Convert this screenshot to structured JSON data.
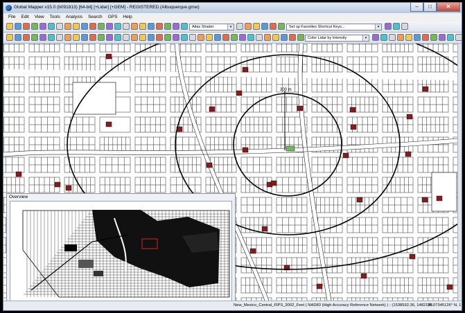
{
  "window": {
    "title": "Global Mapper v15.0 (b091813) [64-bit] [+Lidar] [+GEM] - REGISTERED (Albuquerque.gmw)",
    "minimize": "–",
    "maximize": "□",
    "close": "✕"
  },
  "menu": [
    "File",
    "Edit",
    "View",
    "Tools",
    "Analysis",
    "Search",
    "GPS",
    "Help"
  ],
  "toolbar1": {
    "shader": "Atlas Shader",
    "shortcuts": "Set up Favorites Shortcut Keys..."
  },
  "toolbar2": {
    "lidar": "Color Lidar by Intensity"
  },
  "map": {
    "range_label": "300 m"
  },
  "overview": {
    "title": "Overview"
  },
  "status": {
    "projection": "New_Mexico_Central_FIPS_3002_Feet ( NAD83 (High Accuracy Reference Network) ) - (1538592.36, 1482198.",
    "coords": "35.07345126° N, 1"
  },
  "colors": {
    "parcel_fill": "#8b1a1a",
    "selected_parcel": "#6fb85f",
    "title_gradient_top": "#dfe8f3"
  }
}
